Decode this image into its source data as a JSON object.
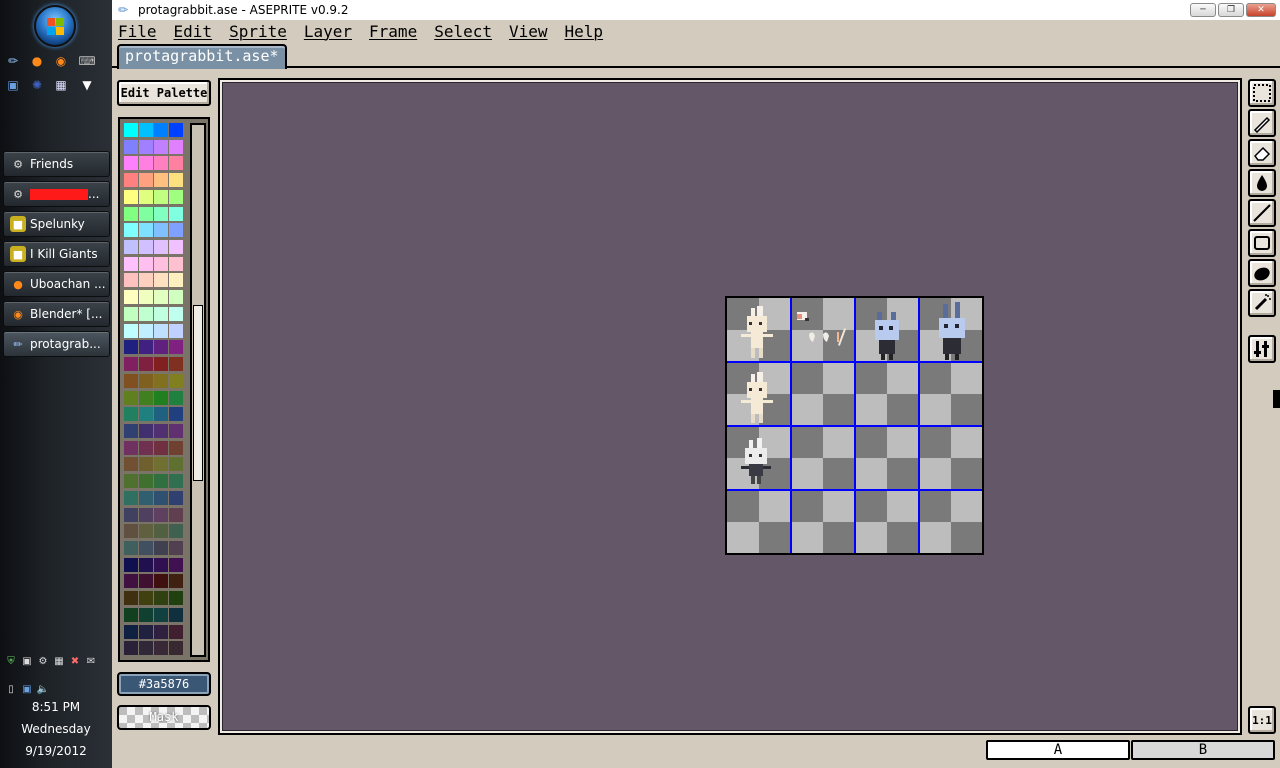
{
  "window": {
    "title": "protagrabbit.ase - ASEPRITE v0.9.2"
  },
  "menu": [
    "File",
    "Edit",
    "Sprite",
    "Layer",
    "Frame",
    "Select",
    "View",
    "Help"
  ],
  "tab": {
    "label": "protagrabbit.ase*"
  },
  "palette": {
    "edit_label": "Edit Palette",
    "selected_color": "#3a5876",
    "selected_label": "#3a5876",
    "mask_label": "Mask",
    "colors": [
      "#00ffff",
      "#00c0ff",
      "#0080ff",
      "#0040ff",
      "#8080ff",
      "#a080ff",
      "#c080ff",
      "#e080ff",
      "#ff80ff",
      "#ff80e0",
      "#ff80c0",
      "#ff80a0",
      "#ff8080",
      "#ffa080",
      "#ffc080",
      "#ffe080",
      "#ffff80",
      "#e0ff80",
      "#c0ff80",
      "#a0ff80",
      "#80ff80",
      "#80ffa0",
      "#80ffc0",
      "#80ffe0",
      "#80ffff",
      "#80e0ff",
      "#80c0ff",
      "#80a0ff",
      "#c0c0ff",
      "#d0c0ff",
      "#e0c0ff",
      "#f0c0ff",
      "#ffc0ff",
      "#ffc0f0",
      "#ffc0e0",
      "#ffc0d0",
      "#ffc0c0",
      "#ffd0c0",
      "#ffe0c0",
      "#fff0c0",
      "#ffffc0",
      "#f0ffc0",
      "#e0ffc0",
      "#d0ffc0",
      "#c0ffc0",
      "#c0ffd0",
      "#c0ffe0",
      "#c0fff0",
      "#c0ffff",
      "#c0f0ff",
      "#c0e0ff",
      "#c0d0ff",
      "#202080",
      "#402080",
      "#602080",
      "#802080",
      "#802060",
      "#802040",
      "#802020",
      "#803020",
      "#805020",
      "#806020",
      "#807020",
      "#808020",
      "#608020",
      "#408020",
      "#208020",
      "#208040",
      "#208060",
      "#208080",
      "#206080",
      "#204080",
      "#304070",
      "#403070",
      "#503070",
      "#603070",
      "#703060",
      "#703050",
      "#703040",
      "#704030",
      "#705030",
      "#706030",
      "#707030",
      "#607030",
      "#507030",
      "#407030",
      "#307040",
      "#307050",
      "#307060",
      "#306070",
      "#305070",
      "#304070",
      "#404060",
      "#504060",
      "#604060",
      "#604050",
      "#605040",
      "#606040",
      "#506040",
      "#406050",
      "#406060",
      "#405060",
      "#404050",
      "#504050",
      "#101050",
      "#201050",
      "#301050",
      "#401050",
      "#401040",
      "#401030",
      "#401010",
      "#402010",
      "#403010",
      "#404010",
      "#304010",
      "#204010",
      "#104020",
      "#104030",
      "#104040",
      "#103040",
      "#102040",
      "#202040",
      "#302040",
      "#402030",
      "#2a2038",
      "#302838",
      "#382838",
      "#382830"
    ]
  },
  "statusbar": {
    "layer_a": "A",
    "layer_b": "B"
  },
  "toolbar": {
    "tools": [
      "marquee-icon",
      "pencil-icon",
      "eraser-icon",
      "bucket-icon",
      "line-icon",
      "rectangle-icon",
      "ellipse-icon",
      "spray-icon",
      "options-icon"
    ],
    "zoom_label": "1:1"
  },
  "taskbar": {
    "items": [
      {
        "label": "Friends",
        "icon": "steam-icon"
      },
      {
        "label": "...",
        "icon": "steam-icon",
        "redacted": true
      },
      {
        "label": "Spelunky",
        "icon": "game-icon"
      },
      {
        "label": "I Kill Giants",
        "icon": "game-icon"
      },
      {
        "label": "Uboachan ...",
        "icon": "firefox-icon"
      },
      {
        "label": "Blender* [...",
        "icon": "blender-icon"
      },
      {
        "label": "protagrab...",
        "icon": "aseprite-icon"
      }
    ],
    "time": "8:51 PM",
    "day": "Wednesday",
    "date": "9/19/2012"
  },
  "colors": {
    "canvas_bg": "#645768",
    "grid_line": "#0000ff",
    "chrome": "#d2cbbe",
    "tab": "#7a90a4"
  }
}
